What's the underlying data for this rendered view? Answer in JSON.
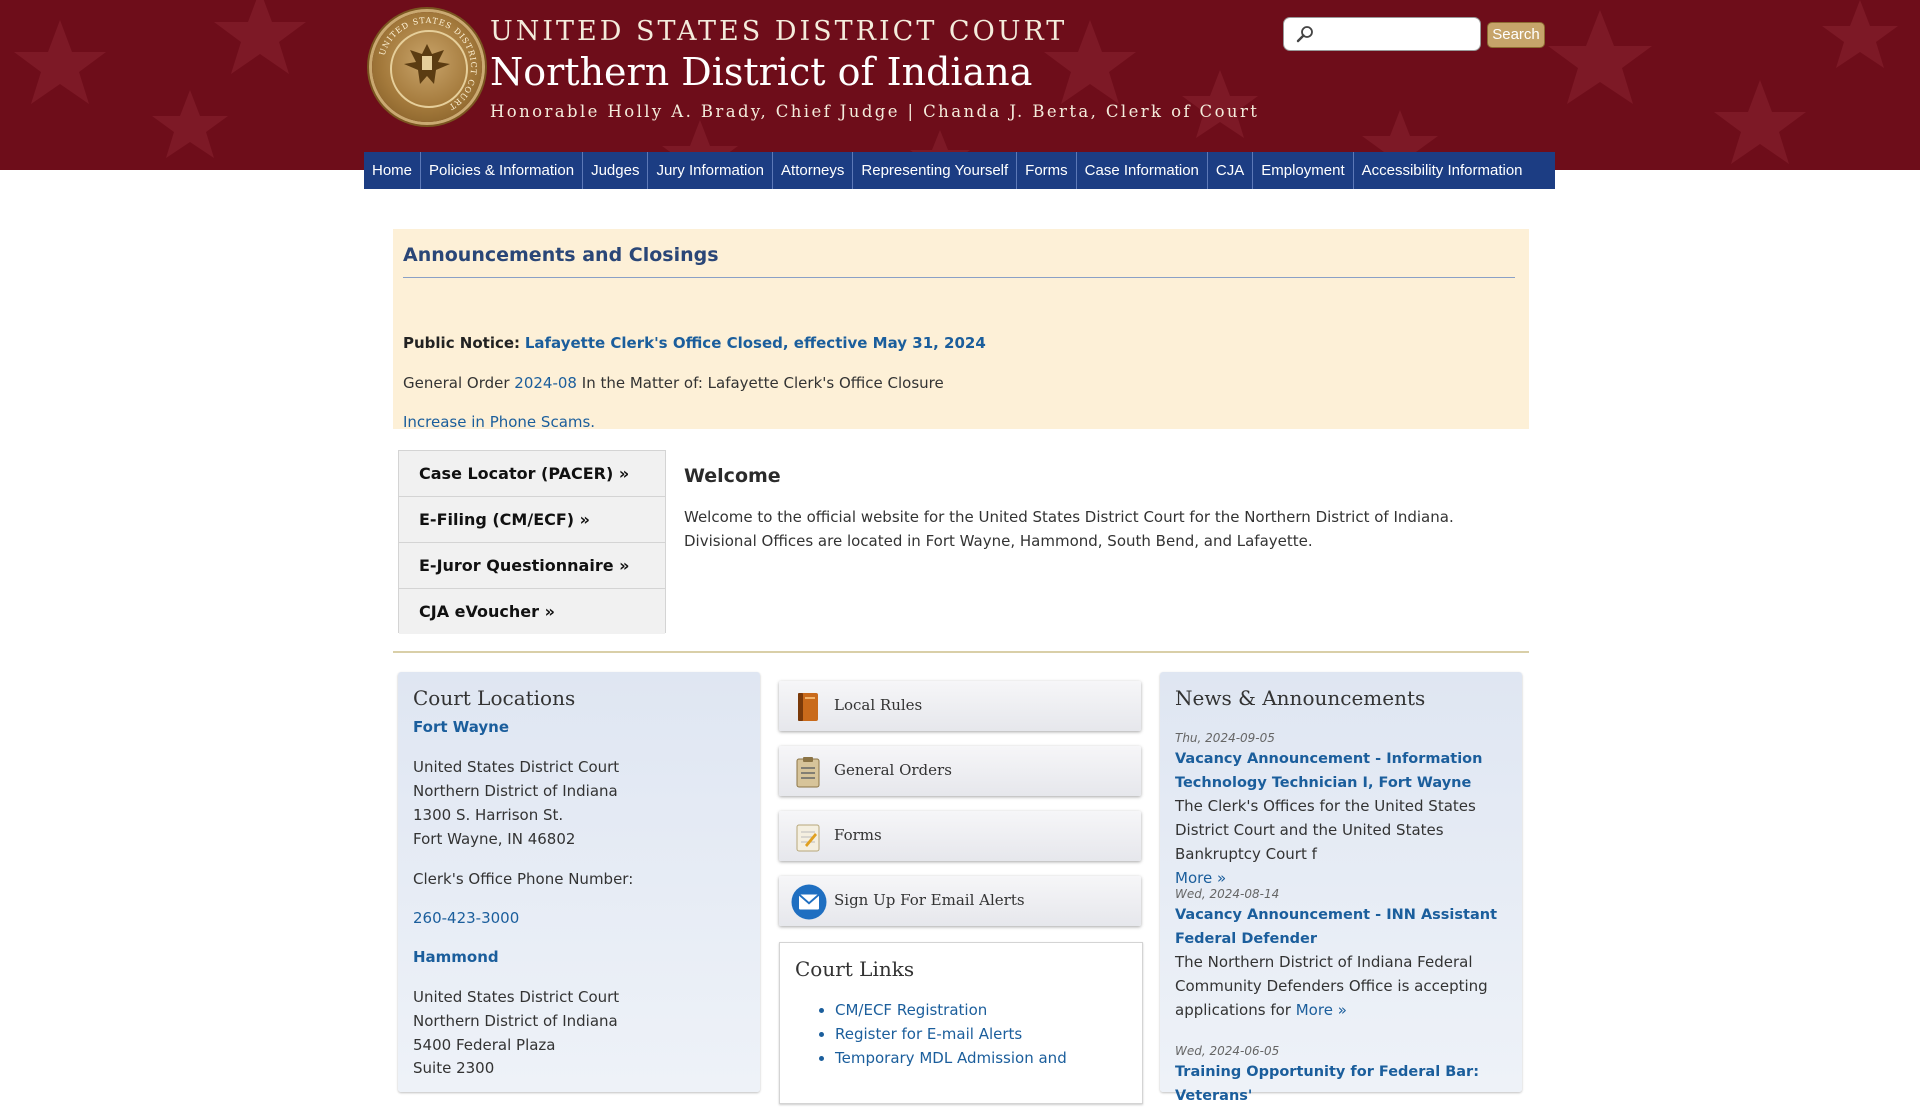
{
  "header": {
    "seal_text": "UNITED STATES DISTRICT COURT",
    "court_line1": "UNITED STATES DISTRICT COURT",
    "court_line2": "Northern District of Indiana",
    "court_line3": "Honorable Holly A. Brady, Chief Judge | Chanda J. Berta, Clerk of Court",
    "search_placeholder": "",
    "search_button": "Search",
    "colors": {
      "header_bg": "#6e0d1a",
      "nav_bg": "#1c3d83",
      "search_btn": "#c6a46a"
    }
  },
  "nav": {
    "items": [
      {
        "label": "Home"
      },
      {
        "label": "Policies & Information"
      },
      {
        "label": "Judges"
      },
      {
        "label": "Jury Information"
      },
      {
        "label": "Attorneys"
      },
      {
        "label": "Representing Yourself"
      },
      {
        "label": "Forms"
      },
      {
        "label": "Case Information"
      },
      {
        "label": "CJA"
      },
      {
        "label": "Employment"
      },
      {
        "label": "Accessibility Information"
      }
    ]
  },
  "announcements": {
    "title": "Announcements and Closings",
    "notice_label": "Public Notice:",
    "notice_link": "Lafayette Clerk's Office Closed, effective May 31, 2024",
    "order_prefix": "General Order",
    "order_link": "2024-08",
    "order_suffix": "In the Matter of: Lafayette Clerk's Office Closure",
    "scam_link": "Increase in Phone Scams."
  },
  "quicklinks": {
    "items": [
      {
        "label": "Case Locator (PACER) »"
      },
      {
        "label": "E-Filing (CM/ECF) »"
      },
      {
        "label": "E-Juror Questionnaire »"
      },
      {
        "label": "CJA eVoucher »"
      }
    ]
  },
  "welcome": {
    "title": "Welcome",
    "text": "Welcome to the official website for the United States District Court for the Northern District of Indiana.  Divisional Offices are located in Fort Wayne, Hammond, South Bend, and Lafayette."
  },
  "locations": {
    "title": "Court Locations",
    "fort_wayne": {
      "city": "Fort Wayne",
      "line1": "United States District Court",
      "line2": "Northern District of Indiana",
      "line3": "1300 S. Harrison St.",
      "line4": "Fort Wayne, IN 46802",
      "phone_label": "Clerk's Office Phone Number:",
      "phone": "260-423-3000"
    },
    "hammond": {
      "city": "Hammond",
      "line1": "United States District Court",
      "line2": "Northern District of Indiana",
      "line3": "5400 Federal Plaza",
      "line4": "Suite 2300"
    }
  },
  "resources": {
    "items": [
      {
        "label": "Local Rules",
        "icon": "book-icon"
      },
      {
        "label": "General Orders",
        "icon": "clipboard-icon"
      },
      {
        "label": "Forms",
        "icon": "notepad-icon"
      },
      {
        "label": "Sign Up For Email Alerts",
        "icon": "envelope-icon"
      }
    ]
  },
  "court_links": {
    "title": "Court Links",
    "items": [
      {
        "label": "CM/ECF Registration"
      },
      {
        "label": "Register for E-mail Alerts"
      },
      {
        "label": "Temporary MDL Admission and"
      }
    ]
  },
  "news": {
    "title": "News & Announcements",
    "items": [
      {
        "date": "Thu, 2024-09-05",
        "title": "Vacancy Announcement - Information Technology Technician I, Fort Wayne",
        "body": "The Clerk's Offices for the United States District Court and the United States Bankruptcy Court f",
        "more": "More »"
      },
      {
        "date": "Wed, 2024-08-14",
        "title": "Vacancy Announcement - INN Assistant Federal Defender",
        "body": "The Northern District of Indiana Federal Community Defenders Office is accepting applications for",
        "more": "More »"
      },
      {
        "date": "Wed, 2024-06-05",
        "title": "Training Opportunity for Federal Bar: Veterans'"
      }
    ]
  }
}
